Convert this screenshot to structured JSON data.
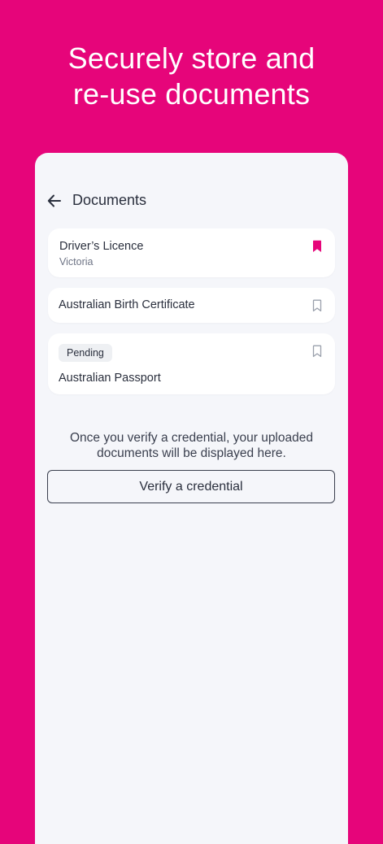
{
  "promo": {
    "line1": "Securely store and",
    "line2": "re-use documents"
  },
  "header": {
    "title": "Documents"
  },
  "documents": [
    {
      "title": "Driver’s Licence",
      "subtitle": "Victoria",
      "bookmarked": true
    },
    {
      "title": "Australian Birth Certificate",
      "bookmarked": false
    },
    {
      "title": "Australian Passport",
      "status": "Pending",
      "bookmarked": false
    }
  ],
  "empty_state": {
    "line1": "Once you verify a credential, your uploaded",
    "line2": "documents will be displayed here."
  },
  "actions": {
    "verify_label": "Verify a credential"
  },
  "colors": {
    "brand": "#E6057A",
    "background": "#F5F6FA",
    "text": "#2A2F3D",
    "muted": "#6E7485",
    "bookmark_inactive": "#9AA0AC"
  },
  "icons": {
    "back": "arrow-left-icon",
    "bookmark_filled": "bookmark-filled-icon",
    "bookmark_outline": "bookmark-outline-icon"
  }
}
